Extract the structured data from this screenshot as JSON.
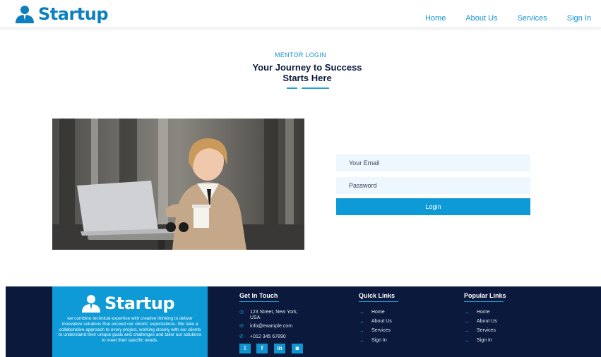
{
  "header": {
    "brand": "Startup",
    "nav": [
      "Home",
      "About Us",
      "Services",
      "Sign In"
    ]
  },
  "section": {
    "eyebrow": "MENTOR LOGIN",
    "title_line1": "Your Journey to Success",
    "title_line2": "Starts Here"
  },
  "login": {
    "email_placeholder": "Your Email",
    "password_placeholder": "Password",
    "button": "Login"
  },
  "footer": {
    "brand": "Startup",
    "description": "we combine technical expertise with creative thinking to deliver innovative solutions that exceed our clients' expectations. We take a collaborative approach to every project, working closely with our clients to understand their unique goals and challenges and tailor our solutions to meet their specific needs.",
    "get_in_touch": {
      "title": "Get In Touch",
      "address_line1": "123 Street, New York,",
      "address_line2": "USA",
      "email": "info@example.com",
      "phone": "+012 345 67890"
    },
    "social": [
      "twitter-icon",
      "facebook-icon",
      "linkedin-icon",
      "instagram-icon"
    ],
    "quick_links": {
      "title": "Quick Links",
      "items": [
        "Home",
        "About Us",
        "Services",
        "Sign In"
      ]
    },
    "popular_links": {
      "title": "Popular Links",
      "items": [
        "Home",
        "About Us",
        "Services",
        "Sign In"
      ]
    }
  },
  "colors": {
    "primary": "#0d9ad6",
    "dark": "#0b1a3c",
    "field_bg": "#eef7fd"
  }
}
